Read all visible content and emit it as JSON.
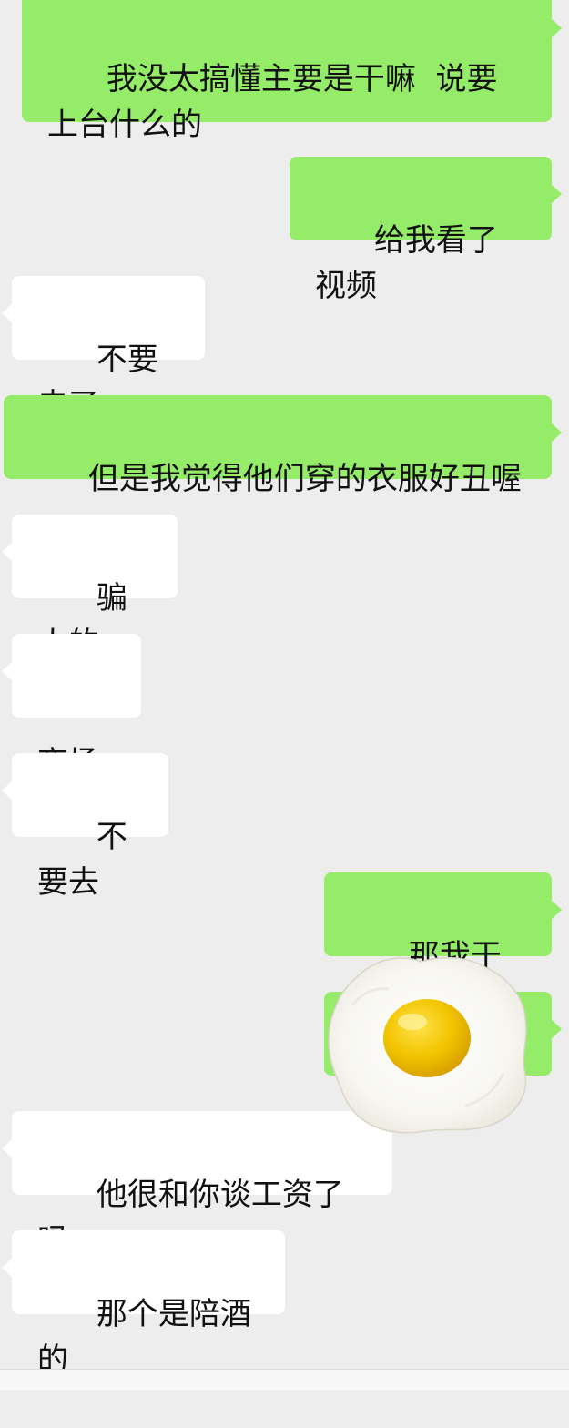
{
  "messages": [
    {
      "side": "sent",
      "text": "我没太搞懂主要是干嘛  说要上台什么的"
    },
    {
      "side": "sent",
      "text": "给我看了视频"
    },
    {
      "side": "received",
      "text": "不要去了"
    },
    {
      "side": "sent",
      "text": "但是我觉得他们穿的衣服好丑喔"
    },
    {
      "side": "received",
      "text": "骗人的"
    },
    {
      "side": "received",
      "text": "夜场"
    },
    {
      "side": "received",
      "text": "不要去"
    },
    {
      "side": "sent",
      "text": "那我干啥呀"
    },
    {
      "side": "sent",
      "text": "",
      "obscured_by": "fried-egg sticker"
    },
    {
      "side": "received",
      "text": "他很和你谈工资了吗"
    },
    {
      "side": "received",
      "text": "那个是陪酒的"
    }
  ],
  "sticker": {
    "icon": "fried-egg-icon"
  },
  "colors": {
    "background": "#ededed",
    "sent_bubble": "#95ec69",
    "received_bubble": "#ffffff",
    "text": "#111111"
  }
}
